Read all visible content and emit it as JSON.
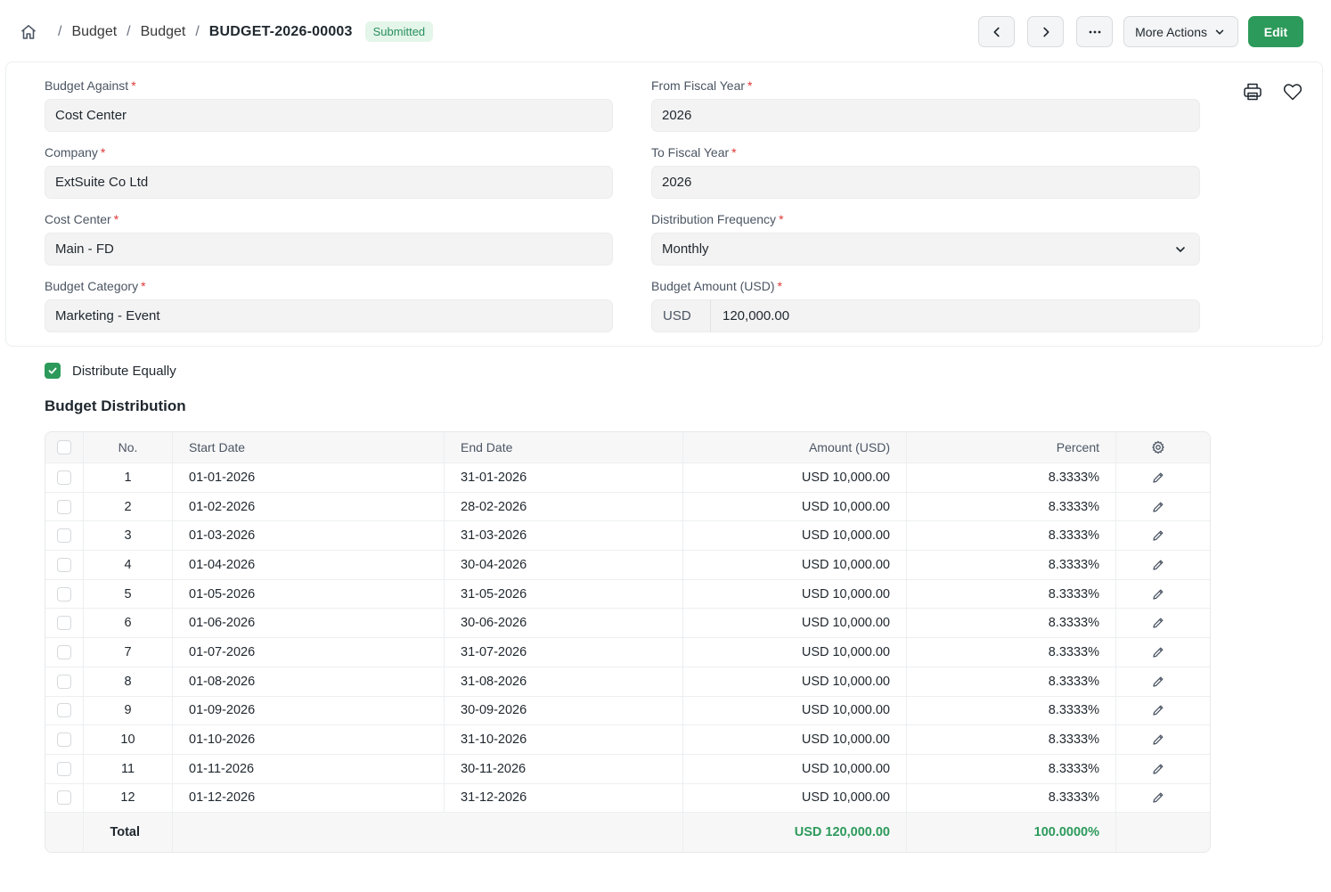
{
  "breadcrumb": {
    "items": [
      "Budget",
      "Budget"
    ],
    "doc_id": "BUDGET-2026-00003",
    "status": "Submitted"
  },
  "actions": {
    "more_label": "More Actions",
    "edit_label": "Edit"
  },
  "form": {
    "budget_against": {
      "label": "Budget Against",
      "value": "Cost Center"
    },
    "company": {
      "label": "Company",
      "value": "ExtSuite Co Ltd"
    },
    "cost_center": {
      "label": "Cost Center",
      "value": "Main - FD"
    },
    "budget_category": {
      "label": "Budget Category",
      "value": "Marketing - Event"
    },
    "from_fiscal_year": {
      "label": "From Fiscal Year",
      "value": "2026"
    },
    "to_fiscal_year": {
      "label": "To Fiscal Year",
      "value": "2026"
    },
    "distribution_frequency": {
      "label": "Distribution Frequency",
      "value": "Monthly"
    },
    "budget_amount": {
      "label": "Budget Amount (USD)",
      "currency": "USD",
      "value": "120,000.00"
    },
    "required_mark": "*"
  },
  "distribute_equally": {
    "label": "Distribute Equally",
    "checked": true
  },
  "section_title": "Budget Distribution",
  "table": {
    "headers": {
      "no": "No.",
      "start": "Start Date",
      "end": "End Date",
      "amount": "Amount (USD)",
      "percent": "Percent"
    },
    "rows": [
      {
        "no": "1",
        "start": "01-01-2026",
        "end": "31-01-2026",
        "amount": "USD 10,000.00",
        "percent": "8.3333%"
      },
      {
        "no": "2",
        "start": "01-02-2026",
        "end": "28-02-2026",
        "amount": "USD 10,000.00",
        "percent": "8.3333%"
      },
      {
        "no": "3",
        "start": "01-03-2026",
        "end": "31-03-2026",
        "amount": "USD 10,000.00",
        "percent": "8.3333%"
      },
      {
        "no": "4",
        "start": "01-04-2026",
        "end": "30-04-2026",
        "amount": "USD 10,000.00",
        "percent": "8.3333%"
      },
      {
        "no": "5",
        "start": "01-05-2026",
        "end": "31-05-2026",
        "amount": "USD 10,000.00",
        "percent": "8.3333%"
      },
      {
        "no": "6",
        "start": "01-06-2026",
        "end": "30-06-2026",
        "amount": "USD 10,000.00",
        "percent": "8.3333%"
      },
      {
        "no": "7",
        "start": "01-07-2026",
        "end": "31-07-2026",
        "amount": "USD 10,000.00",
        "percent": "8.3333%"
      },
      {
        "no": "8",
        "start": "01-08-2026",
        "end": "31-08-2026",
        "amount": "USD 10,000.00",
        "percent": "8.3333%"
      },
      {
        "no": "9",
        "start": "01-09-2026",
        "end": "30-09-2026",
        "amount": "USD 10,000.00",
        "percent": "8.3333%"
      },
      {
        "no": "10",
        "start": "01-10-2026",
        "end": "31-10-2026",
        "amount": "USD 10,000.00",
        "percent": "8.3333%"
      },
      {
        "no": "11",
        "start": "01-11-2026",
        "end": "30-11-2026",
        "amount": "USD 10,000.00",
        "percent": "8.3333%"
      },
      {
        "no": "12",
        "start": "01-12-2026",
        "end": "31-12-2026",
        "amount": "USD 10,000.00",
        "percent": "8.3333%"
      }
    ],
    "total": {
      "label": "Total",
      "amount": "USD 120,000.00",
      "percent": "100.0000%"
    }
  },
  "colors": {
    "primary": "#2c9a5a",
    "required": "#e03636",
    "badge_bg": "#e4f5e9"
  }
}
